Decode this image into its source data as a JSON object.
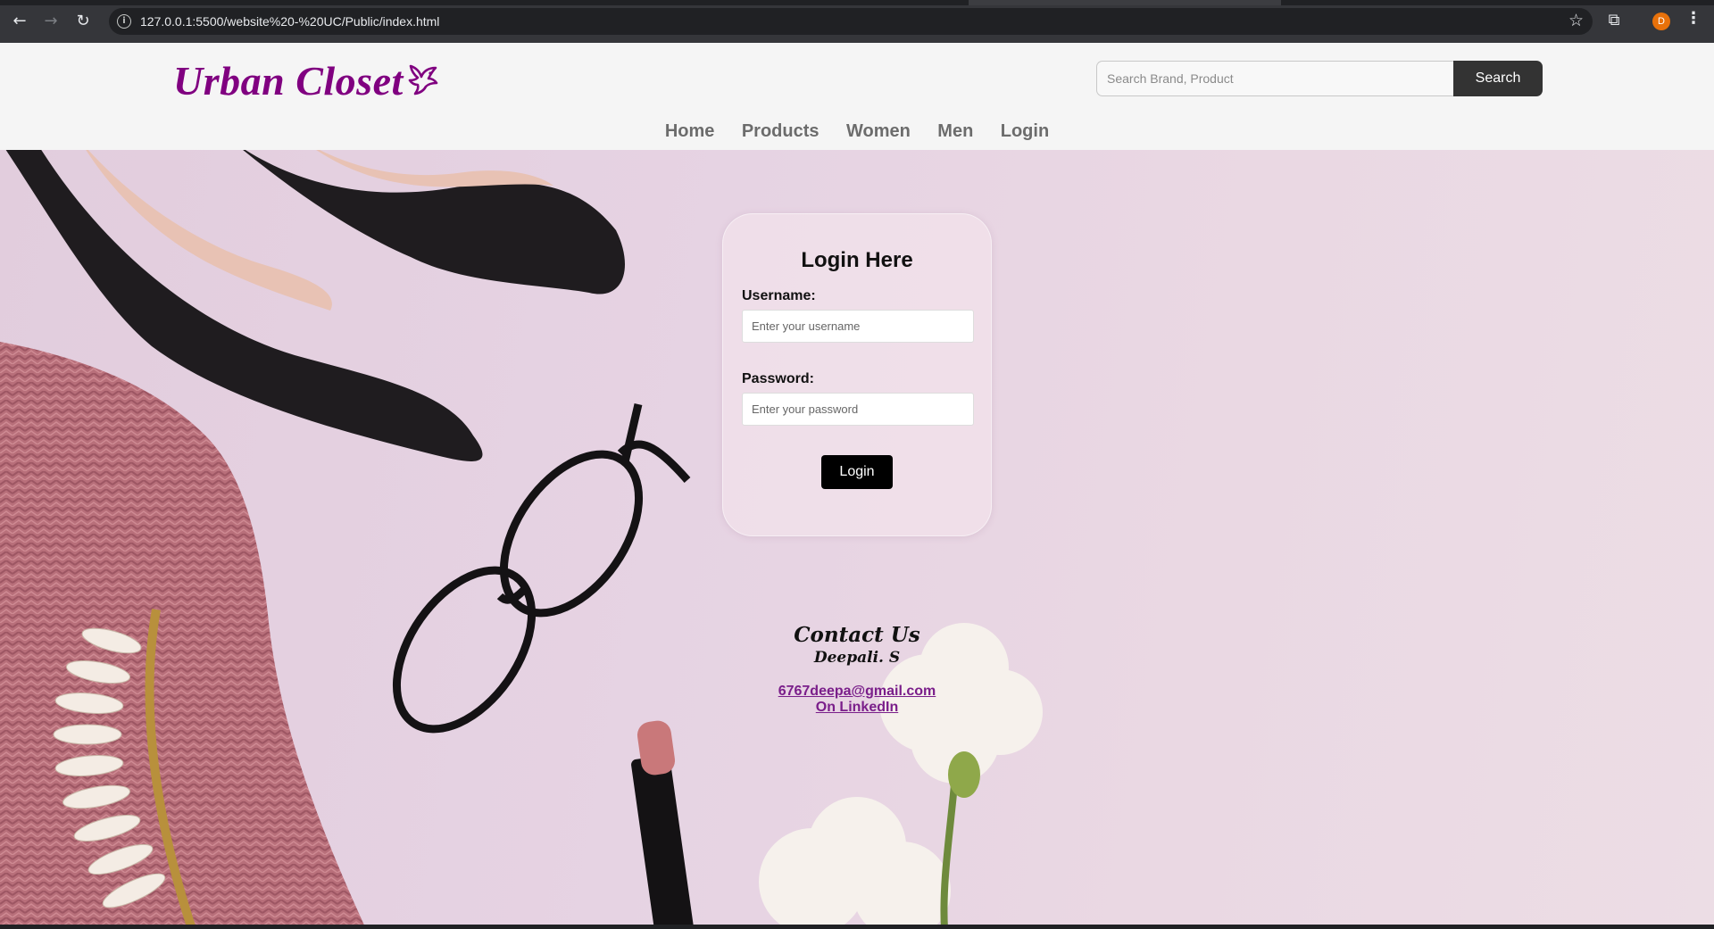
{
  "browser": {
    "url": "127.0.0.1:5500/website%20-%20UC/Public/index.html",
    "profile_initial": "D"
  },
  "header": {
    "logo_text": "Urban Closet",
    "logo_color": "#800080",
    "search_placeholder": "Search Brand, Product",
    "search_button_label": "Search"
  },
  "nav": {
    "items": [
      {
        "label": "Home"
      },
      {
        "label": "Products"
      },
      {
        "label": "Women"
      },
      {
        "label": "Men"
      },
      {
        "label": "Login"
      }
    ]
  },
  "login": {
    "title": "Login Here",
    "username_label": "Username:",
    "username_placeholder": "Enter your username",
    "password_label": "Password:",
    "password_placeholder": "Enter your password",
    "button_label": "Login"
  },
  "contact": {
    "title": "Contact Us",
    "name": "Deepali. S",
    "email": "6767deepa@gmail.com",
    "linkedin": "On LinkedIn",
    "link_color": "#7a1e8a"
  }
}
